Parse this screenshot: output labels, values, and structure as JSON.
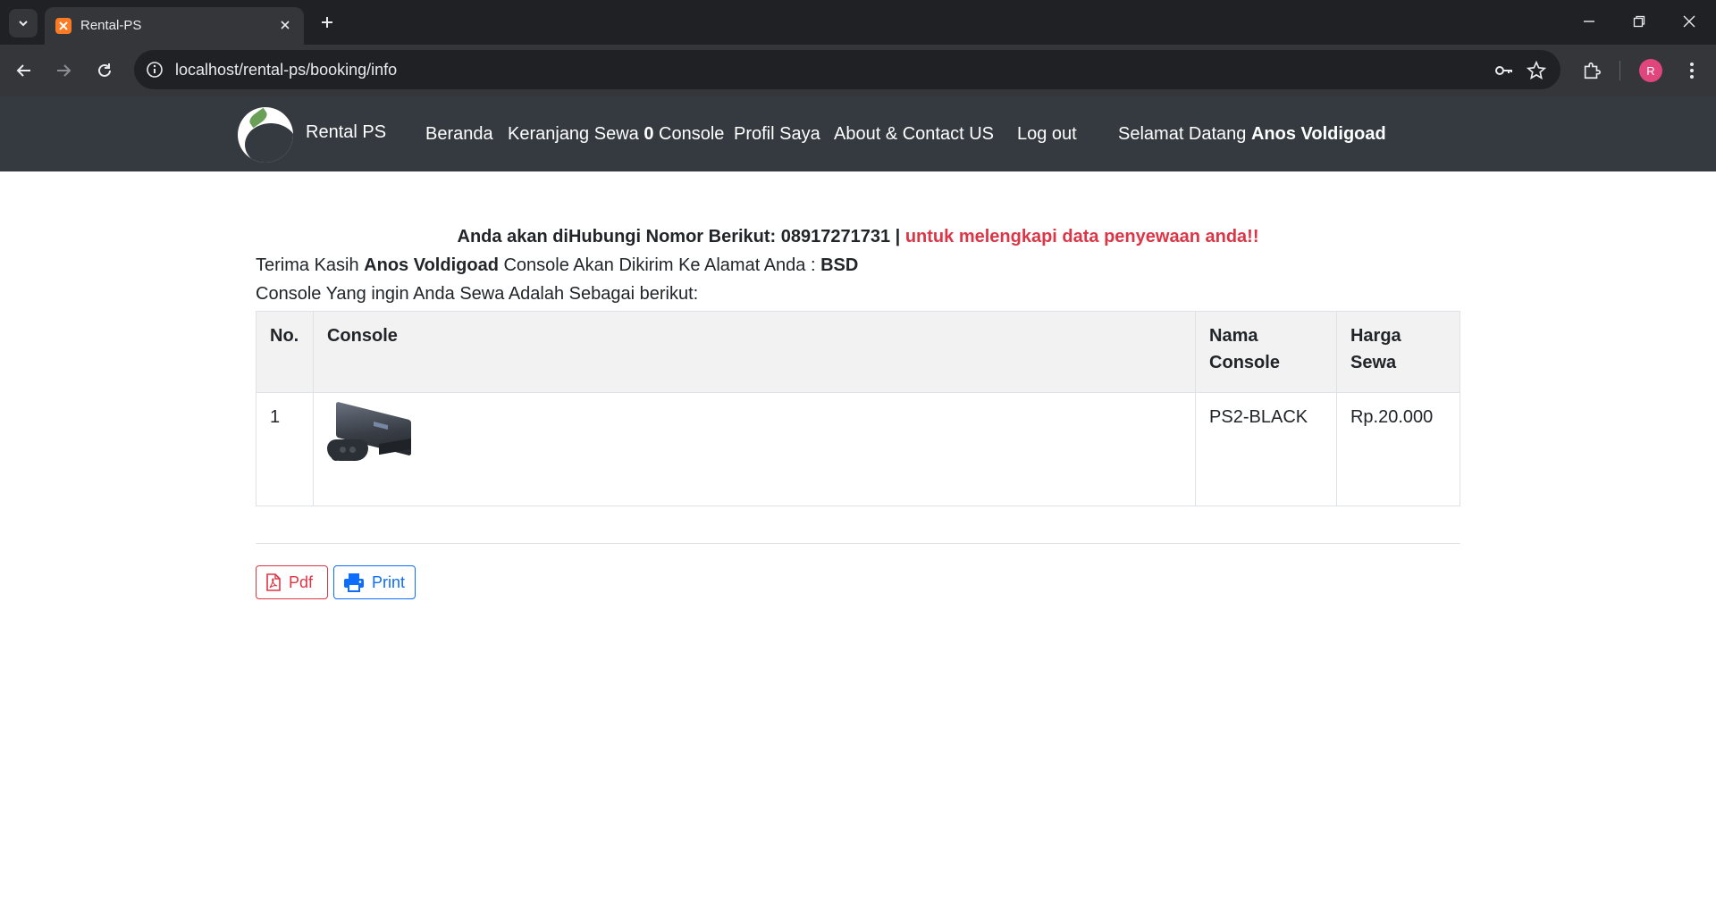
{
  "browser": {
    "tab_title": "Rental-PS",
    "url": "localhost/rental-ps/booking/info",
    "profile_initial": "R"
  },
  "navbar": {
    "brand": "Rental PS",
    "links": {
      "home": "Beranda",
      "cart_prefix": "Keranjang Sewa",
      "cart_count": "0",
      "cart_suffix": "Console",
      "profile": "Profil Saya",
      "about": "About & Contact US",
      "logout": "Log out"
    },
    "welcome_prefix": "Selamat Datang",
    "welcome_user": "Anos Voldigoad"
  },
  "notice": {
    "contact_text": "Anda akan diHubungi Nomor Berikut: 08917271731 |",
    "warning_text": "untuk melengkapi data penyewaan anda!!"
  },
  "thanks": {
    "prefix": "Terima Kasih",
    "user": "Anos Voldigoad",
    "middle": "Console Akan Dikirim Ke Alamat Anda :",
    "address": "BSD"
  },
  "intro": "Console Yang ingin Anda Sewa Adalah Sebagai berikut:",
  "table": {
    "headers": {
      "no": "No.",
      "console": "Console",
      "name_line1": "Nama",
      "name_line2": "Console",
      "price_line1": "Harga",
      "price_line2": "Sewa"
    },
    "rows": [
      {
        "no": "1",
        "image": "ps2-console-image",
        "name": "PS2-BLACK",
        "price": "Rp.20.000"
      }
    ]
  },
  "actions": {
    "pdf_label": "Pdf",
    "print_label": "Print"
  },
  "colors": {
    "navbar_bg": "#343a40",
    "danger": "#dc3545",
    "primary": "#0d6efd",
    "table_head_bg": "#f2f2f2"
  }
}
